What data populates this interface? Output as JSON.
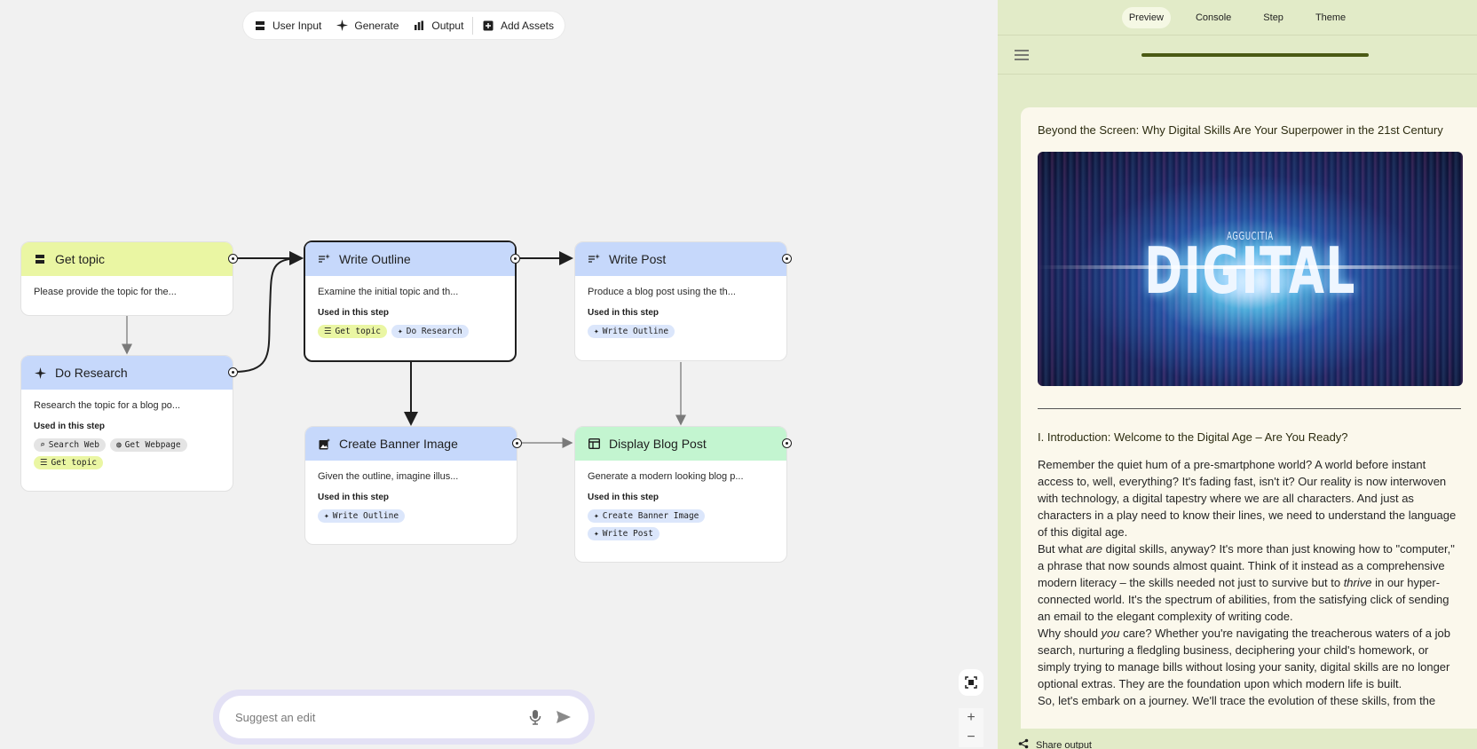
{
  "toolbar": {
    "user_input": "User Input",
    "generate": "Generate",
    "output": "Output",
    "add_assets": "Add Assets"
  },
  "nodes": {
    "get_topic": {
      "title": "Get topic",
      "desc": "Please provide the topic for the..."
    },
    "do_research": {
      "title": "Do Research",
      "desc": "Research the topic for a blog po...",
      "used": "Used in this step",
      "chips": [
        "Search Web",
        "Get Webpage",
        "Get topic"
      ]
    },
    "write_outline": {
      "title": "Write Outline",
      "desc": "Examine the initial topic and th...",
      "used": "Used in this step",
      "chips": [
        "Get topic",
        "Do Research"
      ]
    },
    "write_post": {
      "title": "Write Post",
      "desc": "Produce a blog post using the th...",
      "used": "Used in this step",
      "chips": [
        "Write Outline"
      ]
    },
    "create_banner": {
      "title": "Create Banner Image",
      "desc": "Given the outline, imagine illus...",
      "used": "Used in this step",
      "chips": [
        "Write Outline"
      ]
    },
    "display_post": {
      "title": "Display Blog Post",
      "desc": "Generate a modern looking blog p...",
      "used": "Used in this step",
      "chips": [
        "Create Banner Image",
        "Write Post"
      ]
    }
  },
  "suggest": {
    "placeholder": "Suggest an edit"
  },
  "zoom": {
    "fit_icon": "fit-view-icon",
    "in": "+",
    "out": "−"
  },
  "panel": {
    "tabs": [
      "Preview",
      "Console",
      "Step",
      "Theme"
    ],
    "active_tab": "Preview",
    "progress": 1.0,
    "post": {
      "title": "Beyond the Screen: Why Digital Skills Are Your Superpower in the 21st Century",
      "banner_word": "DIGITAL",
      "banner_small": "AGGUCITIA",
      "section_heading": "I. Introduction: Welcome to the Digital Age – Are You Ready?",
      "p1": "Remember the quiet hum of a pre-smartphone world? A world before instant access to, well, everything? It's fading fast, isn't it? Our reality is now interwoven with technology, a digital tapestry where we are all characters. And just as characters in a play need to know their lines, we need to understand the language of this digital age.",
      "p2_a": "But what ",
      "p2_em": "are",
      "p2_b": " digital skills, anyway? It's more than just knowing how to \"computer,\" a phrase that now sounds almost quaint. Think of it instead as a comprehensive modern literacy – the skills needed not just to survive but to ",
      "p2_em2": "thrive",
      "p2_c": " in our hyper-connected world. It's the spectrum of abilities, from the satisfying click of sending an email to the elegant complexity of writing code.",
      "p3_a": "Why should ",
      "p3_em": "you",
      "p3_b": " care? Whether you're navigating the treacherous waters of a job search, nurturing a fledgling business, deciphering your child's homework, or simply trying to manage bills without losing your sanity, digital skills are no longer optional extras. They are the foundation upon which modern life is built.",
      "p4": "So, let's embark on a journey. We'll trace the evolution of these skills, from the"
    },
    "share": "Share output"
  },
  "colors": {
    "yellow_head": "#eaf6a3",
    "blue_head": "#c6d8fb",
    "green_head": "#c3f5d0",
    "panel_bg": "#e2ebc8",
    "progress": "#4a5a14"
  }
}
